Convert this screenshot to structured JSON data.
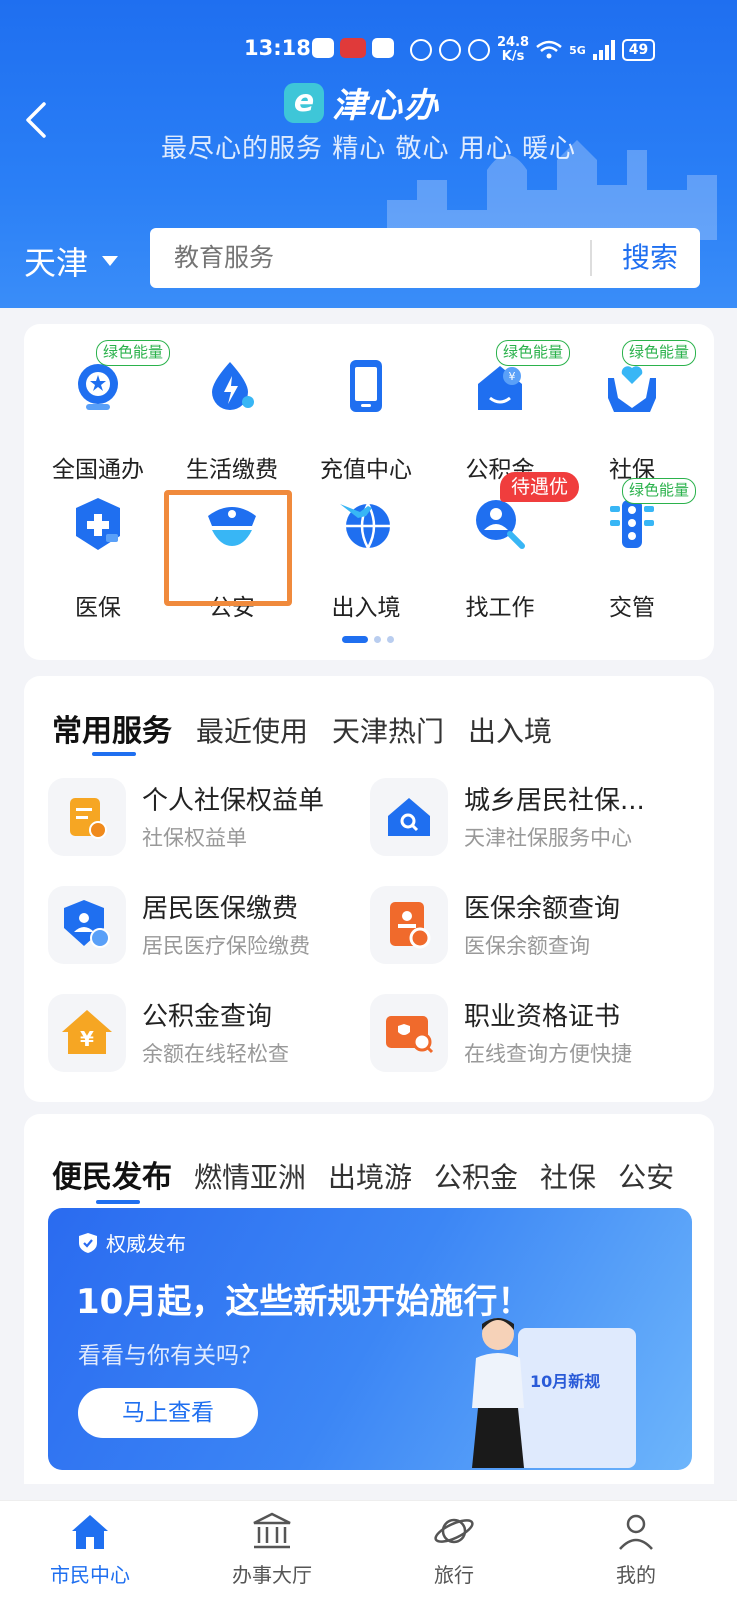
{
  "status_bar": {
    "time": "13:18",
    "net_speed_value": "24.8",
    "net_speed_unit": "K/s",
    "battery": "49",
    "signal": "5G"
  },
  "header": {
    "app_name": "津心办",
    "logo_badge": "e",
    "slogan": "最尽心的服务 精心 敬心 用心 暖心",
    "city": "天津",
    "search_placeholder": "教育服务",
    "search_button": "搜索",
    "accent": "#1f6ff0"
  },
  "grid": {
    "items": [
      {
        "label": "全国通办",
        "icon": "globe-star-icon",
        "tag": "绿色能量"
      },
      {
        "label": "生活缴费",
        "icon": "water-drop-bolt-icon",
        "tag": ""
      },
      {
        "label": "充值中心",
        "icon": "phone-icon",
        "tag": ""
      },
      {
        "label": "公积金",
        "icon": "house-yen-icon",
        "tag": "绿色能量"
      },
      {
        "label": "社保",
        "icon": "hands-heart-icon",
        "tag": "绿色能量"
      },
      {
        "label": "医保",
        "icon": "shield-plus-icon",
        "tag": ""
      },
      {
        "label": "公安",
        "icon": "police-cap-icon",
        "tag": ""
      },
      {
        "label": "出入境",
        "icon": "plane-globe-icon",
        "tag": ""
      },
      {
        "label": "找工作",
        "icon": "person-search-icon",
        "tag": "待遇优"
      },
      {
        "label": "交管",
        "icon": "traffic-light-icon",
        "tag": "绿色能量"
      }
    ],
    "page_count": 3,
    "current_page": 1
  },
  "services": {
    "tabs": [
      "常用服务",
      "最近使用",
      "天津热门",
      "出入境"
    ],
    "active_tab": 0,
    "items": [
      {
        "title": "个人社保权益单",
        "subtitle": "社保权益单",
        "icon": "document-edit-icon"
      },
      {
        "title": "城乡居民社保...",
        "subtitle": "天津社保服务中心",
        "icon": "house-search-icon"
      },
      {
        "title": "居民医保缴费",
        "subtitle": "居民医疗保险缴费",
        "icon": "shield-person-yen-icon"
      },
      {
        "title": "医保余额查询",
        "subtitle": "医保余额查询",
        "icon": "card-person-icon"
      },
      {
        "title": "公积金查询",
        "subtitle": "余额在线轻松查",
        "icon": "house-yen-icon"
      },
      {
        "title": "职业资格证书",
        "subtitle": "在线查询方便快捷",
        "icon": "certificate-search-icon"
      }
    ]
  },
  "news": {
    "tabs": [
      "便民发布",
      "燃情亚洲",
      "出境游",
      "公积金",
      "社保",
      "公安"
    ],
    "active_tab": 0,
    "banner": {
      "badge": "权威发布",
      "title": "10月起，这些新规开始施行！",
      "subtitle": "看看与你有关吗？",
      "button": "马上查看",
      "doc_label": "10月新规"
    }
  },
  "bottom_nav": {
    "items": [
      {
        "label": "市民中心",
        "icon": "home-icon"
      },
      {
        "label": "办事大厅",
        "icon": "bank-building-icon"
      },
      {
        "label": "旅行",
        "icon": "planet-icon"
      },
      {
        "label": "我的",
        "icon": "user-icon"
      }
    ],
    "active": 0
  }
}
